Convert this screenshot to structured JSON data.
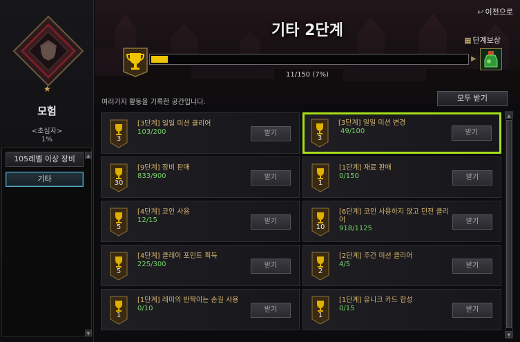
{
  "left": {
    "title": "모험",
    "rank": "<초심자>",
    "percent": "1%",
    "nav": [
      "105레벨 이상 장비",
      "기타"
    ]
  },
  "header": {
    "title": "기타 2단계",
    "back": "이전으로",
    "reward_label": "단계보상",
    "progress_text": "11/150 (7%)",
    "progress_fraction": 0.07,
    "description": "여러가지 활동을 기록한 공간입니다.",
    "claim_all": "모두 받기"
  },
  "missions": [
    {
      "title": "[3단계] 일일 미션 클리어",
      "progress": "103/200",
      "tier": "3",
      "claim": "받기",
      "highlight": false
    },
    {
      "title": "[3단계] 일일 미션 변경",
      "progress": "49/100",
      "tier": "3",
      "claim": "받기",
      "highlight": true
    },
    {
      "title": "[9단계] 장비 판매",
      "progress": "833/900",
      "tier": "30",
      "claim": "받기",
      "highlight": false
    },
    {
      "title": "[1단계] 재료 판매",
      "progress": "0/150",
      "tier": "1",
      "claim": "받기",
      "highlight": false
    },
    {
      "title": "[4단계] 코인 사용",
      "progress": "12/15",
      "tier": "5",
      "claim": "받기",
      "highlight": false
    },
    {
      "title": "[6단계] 코인 사용하지 않고 던전 클리어",
      "progress": "918/1125",
      "tier": "10",
      "claim": "받기",
      "highlight": false
    },
    {
      "title": "[4단계] 클레이 포인트 획득",
      "progress": "225/300",
      "tier": "5",
      "claim": "받기",
      "highlight": false
    },
    {
      "title": "[2단계] 주간 미션 클리어",
      "progress": "4/5",
      "tier": "2",
      "claim": "받기",
      "highlight": false
    },
    {
      "title": "[1단계] 레미의 반짝이는 손길 사용",
      "progress": "0/10",
      "tier": "1",
      "claim": "받기",
      "highlight": false
    },
    {
      "title": "[1단계] 유니크 카드 합성",
      "progress": "0/15",
      "tier": "1",
      "claim": "받기",
      "highlight": false
    }
  ],
  "colors": {
    "accent_gold": "#f0c400",
    "highlight_border": "#a6e01a",
    "progress_green": "#75d36a",
    "title_gold": "#d6b56f"
  }
}
